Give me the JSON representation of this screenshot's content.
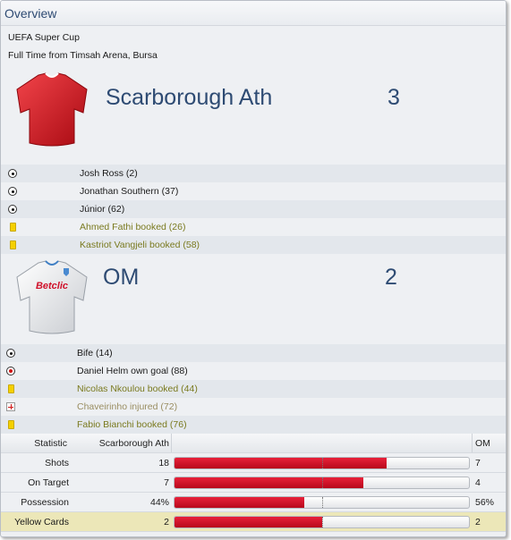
{
  "panel": {
    "title": "Overview"
  },
  "match": {
    "competition": "UEFA Super Cup",
    "result_line": "Full Time from Timsah Arena, Bursa"
  },
  "home": {
    "name": "Scarborough Ath",
    "score": "3",
    "shirt_color": "#d8161e",
    "events": [
      {
        "type": "goal",
        "text": "Josh Ross (2)"
      },
      {
        "type": "goal",
        "text": "Jonathan Southern (37)"
      },
      {
        "type": "goal",
        "text": "Júnior (62)"
      },
      {
        "type": "booking",
        "text": "Ahmed Fathi booked (26)"
      },
      {
        "type": "booking",
        "text": "Kastriot Vangjeli booked (58)"
      }
    ]
  },
  "away": {
    "name": "OM",
    "score": "2",
    "shirt_color": "#f2f2f2",
    "shirt_sponsor": "Betclic",
    "events": [
      {
        "type": "goal",
        "text": "Bife (14)"
      },
      {
        "type": "own-goal",
        "text": "Daniel Helm own goal (88)"
      },
      {
        "type": "booking",
        "text": "Nicolas Nkoulou booked (44)"
      },
      {
        "type": "injury",
        "text": "Chaveirinho injured (72)"
      },
      {
        "type": "booking",
        "text": "Fabio Bianchi booked (76)"
      }
    ]
  },
  "stats": {
    "header": {
      "stat": "Statistic",
      "home": "Scarborough Ath",
      "away": "OM"
    },
    "rows": [
      {
        "label": "Shots",
        "home": "18",
        "away": "7",
        "home_share": 0.72,
        "highlighted": false
      },
      {
        "label": "On Target",
        "home": "7",
        "away": "4",
        "home_share": 0.64,
        "highlighted": false
      },
      {
        "label": "Possession",
        "home": "44%",
        "away": "56%",
        "home_share": 0.44,
        "highlighted": false
      },
      {
        "label": "Yellow Cards",
        "home": "2",
        "away": "2",
        "home_share": 0.5,
        "highlighted": true
      }
    ]
  },
  "colors": {
    "accent": "#2e4b73",
    "bar_fill": "#d0112a",
    "booking_text": "#7a7a1f",
    "highlight_row": "#ece7b8"
  }
}
